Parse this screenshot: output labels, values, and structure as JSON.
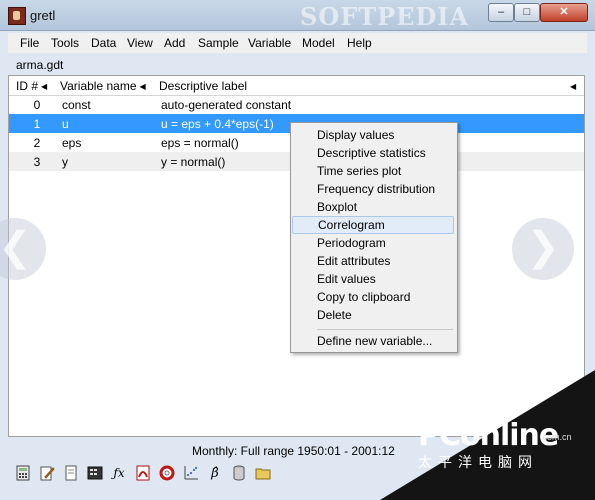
{
  "window": {
    "title": "gretl",
    "watermark": "SOFTPEDIA",
    "min_glyph": "–",
    "max_glyph": "□",
    "close_glyph": "✕"
  },
  "menubar": [
    "File",
    "Tools",
    "Data",
    "View",
    "Add",
    "Sample",
    "Variable",
    "Model",
    "Help"
  ],
  "dataset": {
    "filename": "arma.gdt"
  },
  "table": {
    "headers": {
      "id": "ID #",
      "name": "Variable name",
      "label": "Descriptive label",
      "sort_glyph": "◀"
    },
    "rows": [
      {
        "id": "0",
        "name": "const",
        "label": "auto-generated constant",
        "selected": false
      },
      {
        "id": "1",
        "name": "u",
        "label": "u = eps + 0.4*eps(-1)",
        "selected": true
      },
      {
        "id": "2",
        "name": "eps",
        "label": "eps = normal()",
        "selected": false
      },
      {
        "id": "3",
        "name": "y",
        "label": "y = normal()",
        "selected": false
      }
    ]
  },
  "context_menu": {
    "items": [
      "Display values",
      "Descriptive statistics",
      "Time series plot",
      "Frequency distribution",
      "Boxplot",
      "Correlogram",
      "Periodogram",
      "Edit attributes",
      "Edit values",
      "Copy to clipboard",
      "Delete",
      "Define new variable..."
    ],
    "highlighted": "Correlogram"
  },
  "status": {
    "range": "Monthly: Full range 1950:01 - 2001:12"
  },
  "toolbar_icons": [
    "calculator-icon",
    "edit-script-icon",
    "new-script-icon",
    "console-icon",
    "function-icon",
    "pdf-help-icon",
    "lifebuoy-help-icon",
    "scatter-plot-icon",
    "beta-model-icon",
    "database-icon",
    "folder-icon"
  ],
  "nav": {
    "left": "❮",
    "right": "❯"
  },
  "branding": {
    "logo": "PConline",
    "sub": ".com.cn",
    "chinese": "太平洋电脑网"
  },
  "colors": {
    "selection": "#3399ff",
    "menu_highlight": "#e2ecf8",
    "title_bar": "#c9d8e8"
  }
}
